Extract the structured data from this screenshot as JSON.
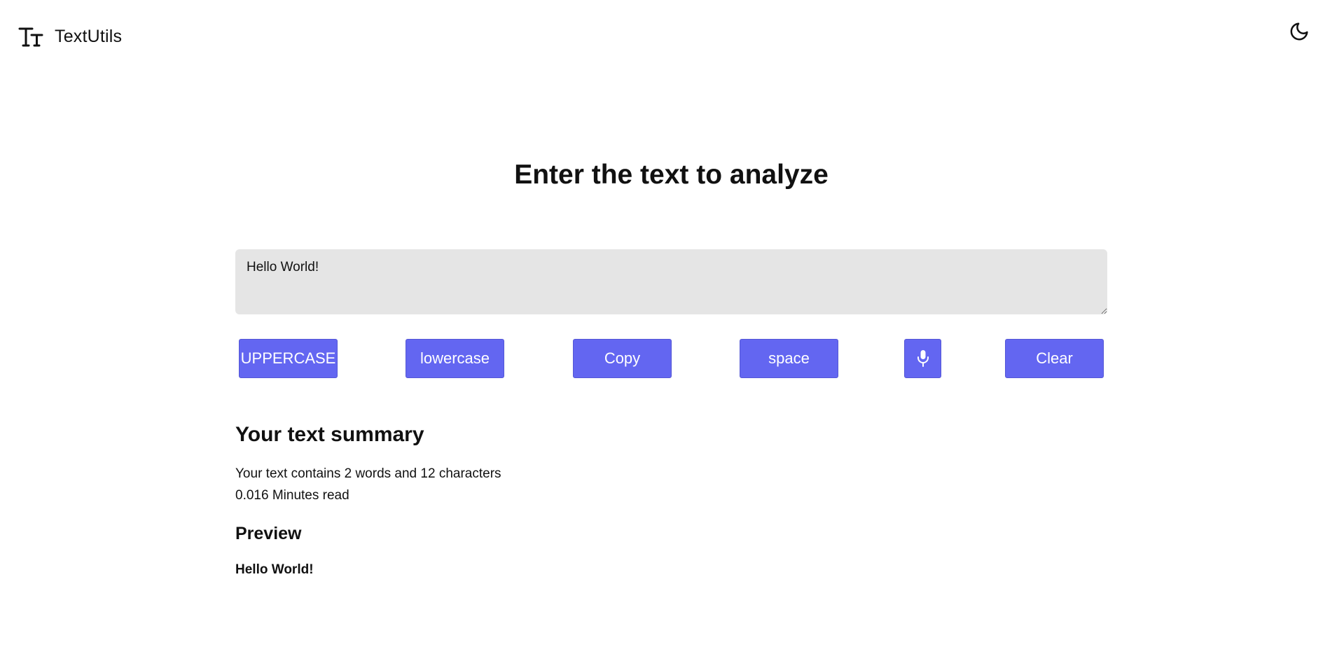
{
  "navbar": {
    "brand_name": "TextUtils",
    "logo_icon": "text-size-icon",
    "theme_toggle_icon": "moon-icon"
  },
  "main": {
    "title": "Enter the text to analyze",
    "textarea_value": "Hello World!",
    "buttons": {
      "uppercase": "UPPERCASE",
      "lowercase": "lowercase",
      "copy": "Copy",
      "space": "space",
      "mic_icon": "microphone-icon",
      "clear": "Clear"
    },
    "accent_color": "#6366f1"
  },
  "summary": {
    "title": "Your text summary",
    "word_char_line": "Your text contains 2 words and 12 characters",
    "read_time_line": "0.016 Minutes read",
    "words": 2,
    "characters": 12,
    "minutes_read": 0.016
  },
  "preview": {
    "title": "Preview",
    "text": "Hello World!"
  }
}
